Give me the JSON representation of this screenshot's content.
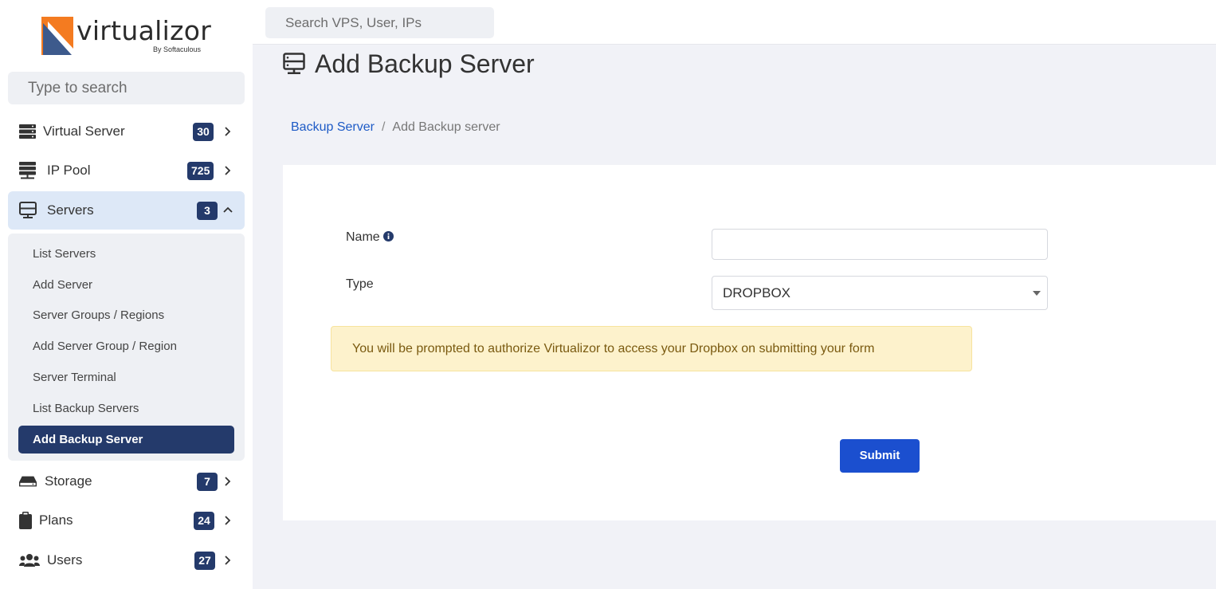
{
  "brand": {
    "name": "virtualizor",
    "byline": "By Softaculous",
    "colors": {
      "orange": "#f47b20",
      "navy": "#3d5a8c"
    }
  },
  "sidebar": {
    "search_placeholder": "Type to search",
    "items": [
      {
        "label": "Virtual Server",
        "count": "30",
        "icon": "server-stack-icon",
        "expanded": false
      },
      {
        "label": "IP Pool",
        "count": "725",
        "icon": "ip-pool-icon",
        "expanded": false
      },
      {
        "label": "Servers",
        "count": "3",
        "icon": "monitor-server-icon",
        "expanded": true
      },
      {
        "label": "Storage",
        "count": "7",
        "icon": "hdd-icon",
        "expanded": false
      },
      {
        "label": "Plans",
        "count": "24",
        "icon": "clipboard-icon",
        "expanded": false
      },
      {
        "label": "Users",
        "count": "27",
        "icon": "users-icon",
        "expanded": false
      }
    ],
    "servers_submenu": [
      "List Servers",
      "Add Server",
      "Server Groups / Regions",
      "Add Server Group / Region",
      "Server Terminal",
      "List Backup Servers",
      "Add Backup Server"
    ],
    "active_submenu": "Add Backup Server"
  },
  "topbar": {
    "search_placeholder": "Search VPS, User, IPs"
  },
  "page": {
    "title": "Add Backup Server",
    "breadcrumb": {
      "link": "Backup Server",
      "separator": "/",
      "current": "Add Backup server"
    }
  },
  "form": {
    "name_label": "Name",
    "name_value": "",
    "type_label": "Type",
    "type_value": "DROPBOX",
    "alert": "You will be prompted to authorize Virtualizor to access your Dropbox on submitting your form",
    "submit_label": "Submit"
  },
  "colors": {
    "badge": "#243a6b",
    "active_item_bg": "#dde8f7",
    "primary_button": "#1b4fcf",
    "link": "#1e5bc6",
    "alert_bg": "#fdf2cc"
  }
}
